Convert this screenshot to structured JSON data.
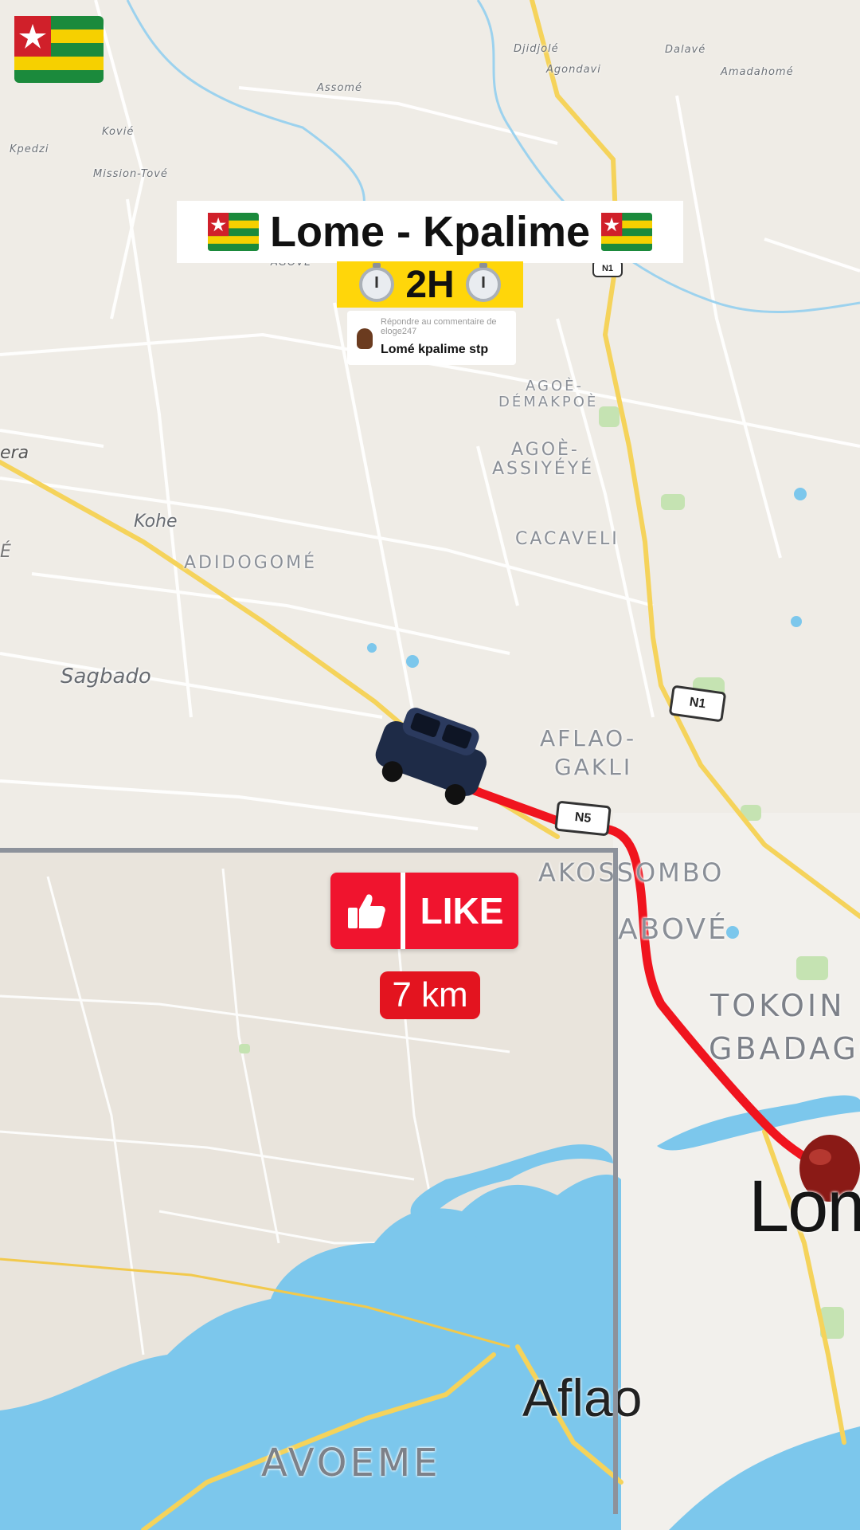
{
  "title": "Lome - Kpalime",
  "duration": "2H",
  "comment": {
    "reply_to": "Répondre au commentaire de eloge247",
    "text": "Lomé kpalime stp"
  },
  "like_label": "LIKE",
  "distance": "7 km",
  "colors": {
    "route": "#f0141e",
    "like_bg": "#f0142e",
    "time_bg": "#ffd60a",
    "water": "#7cc7ec",
    "road_major": "#f5d35b"
  },
  "icons": [
    "togo-flag-icon",
    "stopwatch-icon",
    "thumbs-up-icon",
    "car-icon",
    "destination-marker-icon"
  ],
  "road_shields": [
    "N1",
    "N1",
    "N5"
  ],
  "map_labels": {
    "djidjole": "Djidjolé",
    "agondavi": "Agondavi",
    "dalave": "Dalavé",
    "amadahome": "Amadahomé",
    "assome": "Assomé",
    "kovie": "Kovié",
    "kpedzi": "Kpedzi",
    "mission_tove": "Mission-Tové",
    "agove": "AGOVE",
    "agoe_demakpoe_1": "AGOÈ-",
    "agoe_demakpoe_2": "DÉMAKPOÈ",
    "agoe_assiyeye_1": "AGOÈ-",
    "agoe_assiyeye_2": "ASSIYÉYÉ",
    "era": "era",
    "e": "É",
    "kohe": "Kohe",
    "adidogome": "ADIDOGOMÉ",
    "cacaveli": "CACAVELI",
    "sagbado": "Sagbado",
    "aflao_gakli_1": "AFLAO-",
    "aflao_gakli_2": "GAKLI",
    "akossombo": "AKOSSOMBO",
    "above": "ABOVÉ",
    "tokoin_1": "TOKOIN",
    "tokoin_2": "GBADAGO",
    "lome": "Lom",
    "aflao": "Aflao",
    "avoeme": "AVOEME"
  }
}
